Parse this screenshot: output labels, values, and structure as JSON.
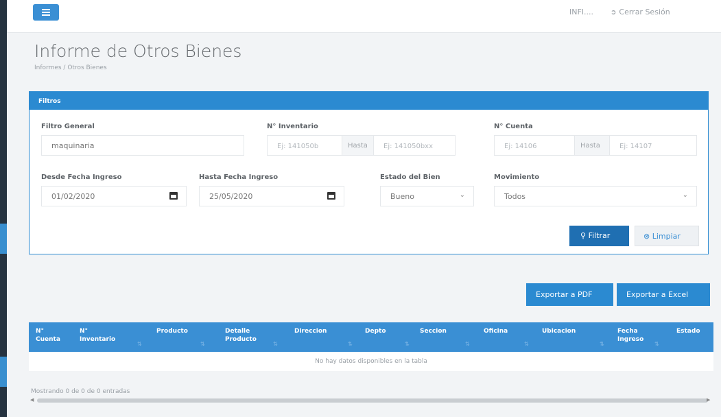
{
  "topbar": {
    "user": "INFI....",
    "logout_label": "Cerrar Sesión"
  },
  "page": {
    "title": "Informe de Otros Bienes",
    "breadcrumb": "Informes / Otros Bienes"
  },
  "filters": {
    "header": "Filtros",
    "general_label": "Filtro General",
    "general_value": "maquinaria",
    "inventory_label": "N° Inventario",
    "inventory_from_placeholder": "Ej: 141050b",
    "hasta": "Hasta",
    "inventory_to_placeholder": "Ej: 141050bxx",
    "account_label": "N° Cuenta",
    "account_from_placeholder": "Ej: 14106",
    "account_to_placeholder": "Ej: 14107",
    "from_date_label": "Desde Fecha Ingreso",
    "from_date_value": "01/02/2020",
    "to_date_label": "Hasta Fecha Ingreso",
    "to_date_value": "25/05/2020",
    "state_label": "Estado del Bien",
    "state_value": "Bueno",
    "movement_label": "Movimiento",
    "movement_value": "Todos",
    "filter_button": "Filtrar",
    "clear_button": "Limpiar"
  },
  "export": {
    "pdf": "Exportar a PDF",
    "excel": "Exportar a Excel"
  },
  "table": {
    "columns": [
      {
        "line1": "N°",
        "line2": "Cuenta"
      },
      {
        "line1": "N°",
        "line2": "Inventario"
      },
      {
        "line1": "Producto",
        "line2": ""
      },
      {
        "line1": "Detalle",
        "line2": "Producto"
      },
      {
        "line1": "Direccion",
        "line2": ""
      },
      {
        "line1": "Depto",
        "line2": ""
      },
      {
        "line1": "Seccion",
        "line2": ""
      },
      {
        "line1": "Oficina",
        "line2": ""
      },
      {
        "line1": "Ubicacion",
        "line2": ""
      },
      {
        "line1": "Fecha",
        "line2": "Ingreso"
      },
      {
        "line1": "Estado",
        "line2": ""
      }
    ],
    "empty_message": "No hay datos disponibles en la tabla",
    "info": "Mostrando 0 de 0 de 0 entradas"
  }
}
